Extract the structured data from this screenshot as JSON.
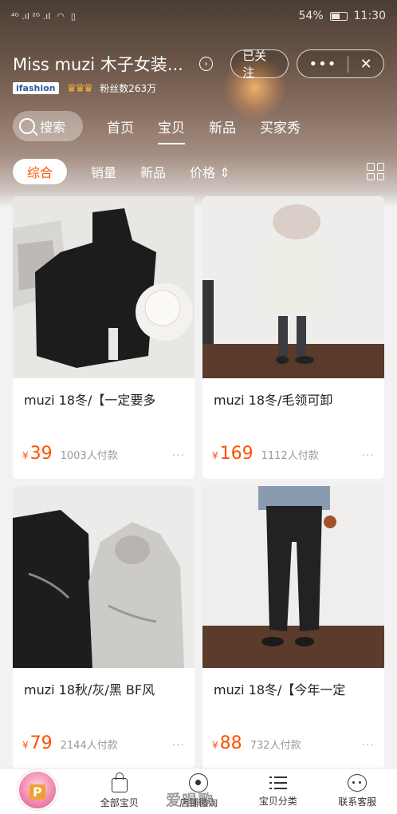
{
  "status_bar": {
    "signal_left": "⁴ᴳ .ıl ²ᴳ .ıl",
    "battery_percent": "54%",
    "time": "11:30"
  },
  "shop": {
    "name": "Miss muzi 木子女装...",
    "follow_label": "已关注",
    "more_label": "•••",
    "close_label": "✕",
    "brand_badge": "ifashion",
    "crowns": "♛♛♛",
    "fans_text": "粉丝数263万"
  },
  "nav": {
    "search_label": "搜索",
    "tabs": [
      {
        "label": "首页"
      },
      {
        "label": "宝贝"
      },
      {
        "label": "新品"
      },
      {
        "label": "买家秀"
      }
    ],
    "active_tab": "宝贝"
  },
  "sort": {
    "items": [
      {
        "label": "综合"
      },
      {
        "label": "销量"
      },
      {
        "label": "新品"
      },
      {
        "label": "价格 ⇕"
      }
    ],
    "active": "综合"
  },
  "products": [
    {
      "title": "muzi 18冬/【一定要多",
      "currency": "¥",
      "price": "39",
      "sales": "1003人付款",
      "more": "···"
    },
    {
      "title": "muzi 18冬/毛领可卸",
      "currency": "¥",
      "price": "169",
      "sales": "1112人付款",
      "more": "···"
    },
    {
      "title": "muzi 18秋/灰/黑 BF风",
      "currency": "¥",
      "price": "79",
      "sales": "2144人付款",
      "more": "···"
    },
    {
      "title": "muzi 18冬/【今年一定",
      "currency": "¥",
      "price": "88",
      "sales": "732人付款",
      "more": "···"
    }
  ],
  "bottom_bar": {
    "items": [
      {
        "label": "全部宝贝",
        "icon": "bag-icon"
      },
      {
        "label": "店铺微淘",
        "icon": "live-icon"
      },
      {
        "label": "宝贝分类",
        "icon": "list-icon"
      },
      {
        "label": "联系客服",
        "icon": "chat-icon"
      }
    ],
    "watermark": "爱唱歌"
  },
  "colors": {
    "accent": "#ff5500",
    "price": "#ff5000"
  }
}
